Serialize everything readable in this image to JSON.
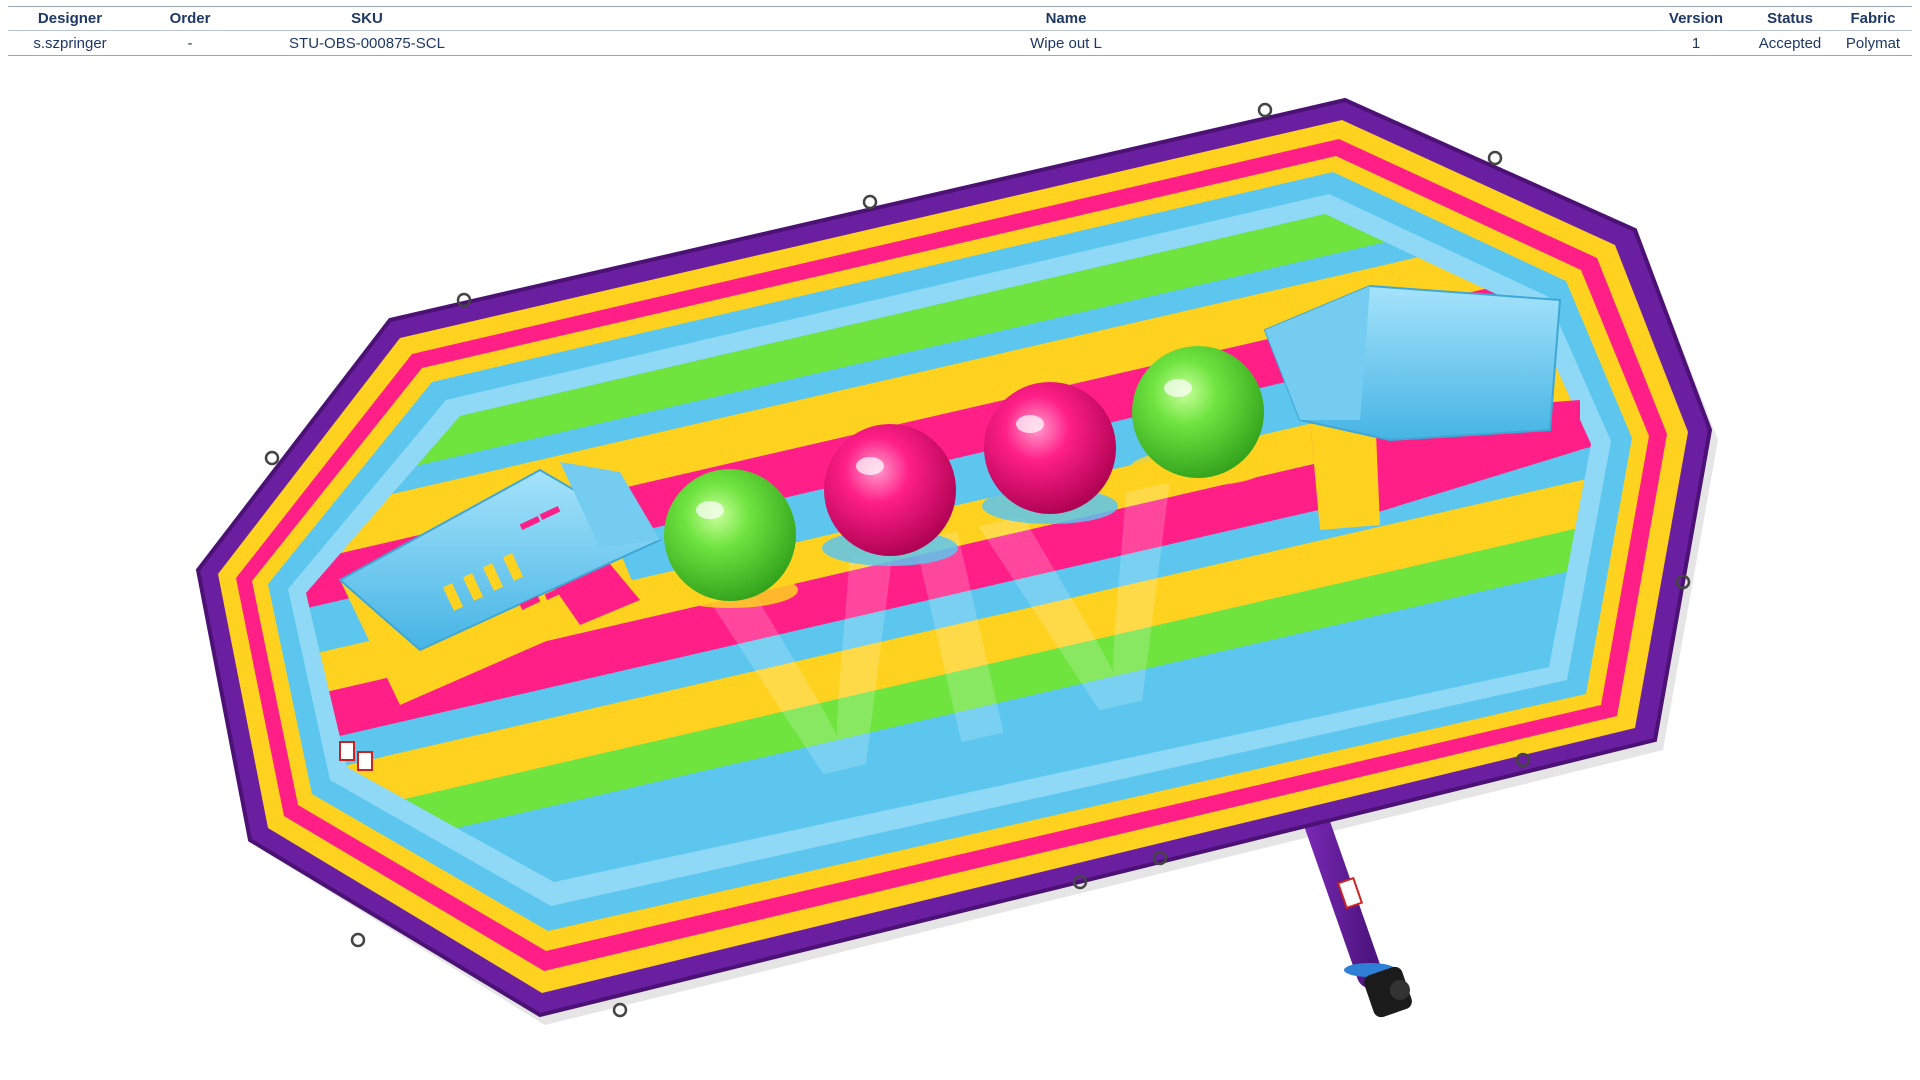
{
  "spec_table": {
    "headers": [
      "Designer",
      "Order",
      "SKU",
      "Name",
      "Version",
      "Status",
      "Fabric"
    ],
    "row": {
      "designer": "s.szpringer",
      "order": "-",
      "sku": "STU-OBS-000875-SCL",
      "name": "Wipe out L",
      "version": "1",
      "status": "Accepted",
      "fabric": "Polymat"
    }
  },
  "render": {
    "watermark": "VIV",
    "colors": {
      "outer_border": "#6a1fa0",
      "yellow": "#ffd21f",
      "pink": "#ff1f87",
      "cyan": "#5cc6ee",
      "green": "#6fe43f",
      "header_text": "#1f3864"
    }
  }
}
